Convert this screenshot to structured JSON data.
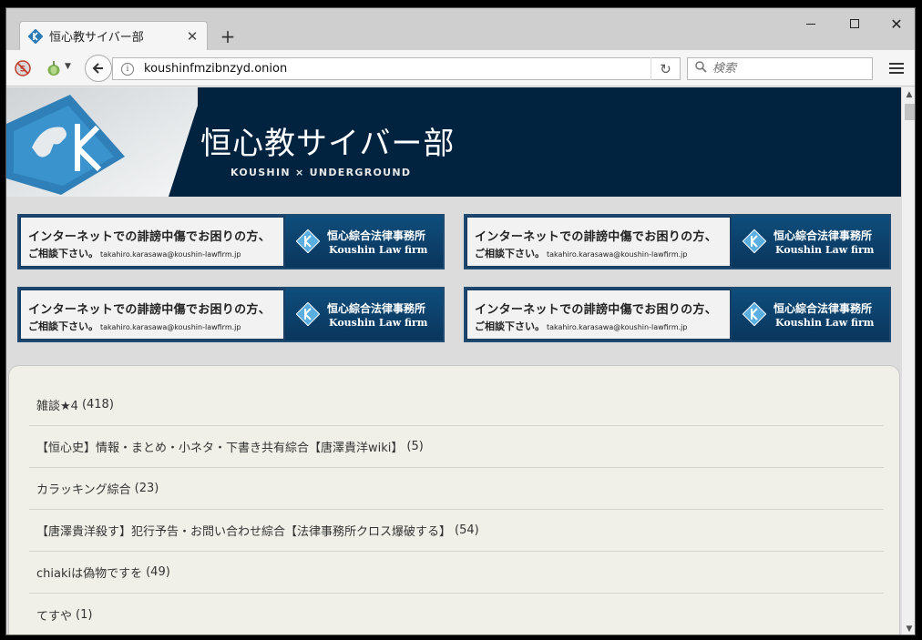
{
  "browser": {
    "tab_title": "恒心教サイバー部",
    "url": "koushinfmzibnzyd.onion",
    "search_placeholder": "検索",
    "colors": {
      "tab_bar": "#cfcfcf",
      "nav_bar": "#f5f5f5"
    }
  },
  "header": {
    "title": "恒心教サイバー部",
    "subtitle": "KOUSHIN × UNDERGROUND",
    "background": "#01233f"
  },
  "banners": [
    {
      "line1": "インターネットでの誹謗中傷でお困りの方、",
      "line2": "ご相談下さい。",
      "email": "takahiro.karasawa@koushin-lawfirm.jp",
      "firm_jp": "恒心綜合法律事務所",
      "firm_en": "Koushin Law firm"
    },
    {
      "line1": "インターネットでの誹謗中傷でお困りの方、",
      "line2": "ご相談下さい。",
      "email": "takahiro.karasawa@koushin-lawfirm.jp",
      "firm_jp": "恒心綜合法律事務所",
      "firm_en": "Koushin Law firm"
    },
    {
      "line1": "インターネットでの誹謗中傷でお困りの方、",
      "line2": "ご相談下さい。",
      "email": "takahiro.karasawa@koushin-lawfirm.jp",
      "firm_jp": "恒心綜合法律事務所",
      "firm_en": "Koushin Law firm"
    },
    {
      "line1": "インターネットでの誹謗中傷でお困りの方、",
      "line2": "ご相談下さい。",
      "email": "takahiro.karasawa@koushin-lawfirm.jp",
      "firm_jp": "恒心綜合法律事務所",
      "firm_en": "Koushin Law firm"
    }
  ],
  "boards": [
    {
      "name": "雑談★4",
      "count": "(418)"
    },
    {
      "name": "【恒心史】情報・まとめ・小ネタ・下書き共有綜合【唐澤貴洋wiki】",
      "count": "(5)"
    },
    {
      "name": "カラッキング綜合",
      "count": "(23)"
    },
    {
      "name": "【唐澤貴洋殺す】犯行予告・お問い合わせ綜合【法律事務所クロス爆破する】",
      "count": "(54)"
    },
    {
      "name": "chiakiは偽物ですを",
      "count": "(49)"
    },
    {
      "name": "てすや",
      "count": "(1)"
    }
  ]
}
